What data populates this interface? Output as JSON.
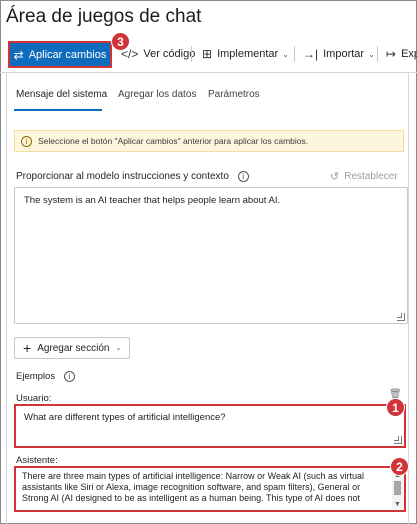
{
  "app": {
    "title": "Área de juegos de chat"
  },
  "toolbar": {
    "apply_label": "Aplicar cambios",
    "view_code_label": "Ver código",
    "deploy_label": "Implementar",
    "import_label": "Importar",
    "export_label": "Exp"
  },
  "annotations": {
    "badge_1": "1",
    "badge_2": "2",
    "badge_3": "3"
  },
  "tabs": [
    {
      "label": "Mensaje del sistema",
      "active": true
    },
    {
      "label": "Agregar los datos",
      "active": false
    },
    {
      "label": "Parámetros",
      "active": false
    }
  ],
  "info_bar": {
    "text": "Seleccione el botón \"Aplicar cambios\" anterior para aplicar los cambios."
  },
  "system_message": {
    "label": "Proporcionar al modelo instrucciones y contexto",
    "reset_label": "Restablecer",
    "value": "The system is an AI teacher that helps people learn about AI."
  },
  "add_section": {
    "label": "Agregar sección"
  },
  "examples": {
    "label": "Ejemplos",
    "user_label": "Usuario:",
    "user_value": "What are different types of artificial intelligence?",
    "assistant_label": "Asistente:",
    "assistant_value": "There are three main types of artificial intelligence: Narrow or Weak AI (such as virtual assistants like Siri or Alexa, image recognition software, and spam filters), General or Strong AI (AI designed to be as intelligent as a human being. This type of AI does not"
  },
  "colors": {
    "accent": "#0f6cbd",
    "annotation_red": "#d13438",
    "info_bg": "#fdf6dc"
  },
  "icons": [
    "arrows-swap-icon",
    "code-icon",
    "grid-icon",
    "import-icon",
    "info-icon",
    "reset-icon",
    "plus-icon",
    "trash-icon"
  ]
}
